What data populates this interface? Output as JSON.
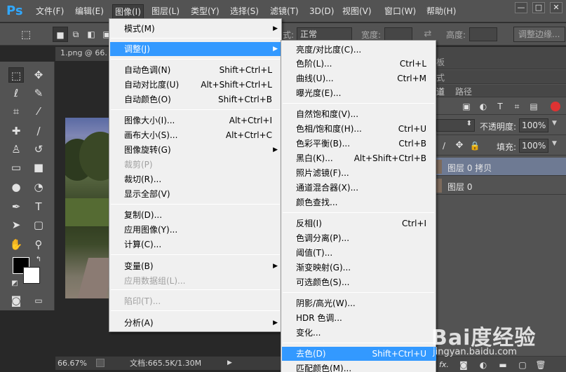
{
  "app": {
    "logo": "Ps"
  },
  "menubar": [
    {
      "label": "文件(F)"
    },
    {
      "label": "编辑(E)"
    },
    {
      "label": "图像(I)"
    },
    {
      "label": "图层(L)"
    },
    {
      "label": "类型(Y)"
    },
    {
      "label": "选择(S)"
    },
    {
      "label": "滤镜(T)"
    },
    {
      "label": "3D(D)"
    },
    {
      "label": "视图(V)"
    },
    {
      "label": "窗口(W)"
    },
    {
      "label": "帮助(H)"
    }
  ],
  "window_controls": {
    "minimize": "—",
    "restore": "□",
    "close": "✕"
  },
  "options": {
    "style_label": "式:",
    "style_value": "正常",
    "width_label": "宽度:",
    "height_label": "高度:",
    "refine_edge": "调整边缘..."
  },
  "document": {
    "tab": "1.png @ 66.",
    "zoom": "66.67%",
    "doc_info": "文档:665.5K/1.30M"
  },
  "panel": {
    "tab_fragment_1": "板",
    "tab_fragment_2": "式",
    "tab_channels": "道",
    "tab_paths": "路径",
    "opacity_label": "不透明度:",
    "opacity_value": "100%",
    "fill_label": "填充:",
    "fill_value": "100%",
    "layers": [
      {
        "name": "图层 0 拷贝",
        "selected": true
      },
      {
        "name": "图层 0",
        "selected": false
      }
    ]
  },
  "image_menu": [
    {
      "label": "模式(M)",
      "shortcut": "",
      "submenu": true
    },
    {
      "label": "调整(J)",
      "shortcut": "",
      "submenu": true,
      "highlight": true
    },
    {
      "label": "自动色调(N)",
      "shortcut": "Shift+Ctrl+L"
    },
    {
      "label": "自动对比度(U)",
      "shortcut": "Alt+Shift+Ctrl+L"
    },
    {
      "label": "自动颜色(O)",
      "shortcut": "Shift+Ctrl+B"
    },
    {
      "label": "图像大小(I)...",
      "shortcut": "Alt+Ctrl+I"
    },
    {
      "label": "画布大小(S)...",
      "shortcut": "Alt+Ctrl+C"
    },
    {
      "label": "图像旋转(G)",
      "shortcut": "",
      "submenu": true
    },
    {
      "label": "裁剪(P)",
      "shortcut": "",
      "disabled": true
    },
    {
      "label": "裁切(R)...",
      "shortcut": ""
    },
    {
      "label": "显示全部(V)",
      "shortcut": ""
    },
    {
      "label": "复制(D)...",
      "shortcut": ""
    },
    {
      "label": "应用图像(Y)...",
      "shortcut": ""
    },
    {
      "label": "计算(C)...",
      "shortcut": ""
    },
    {
      "label": "变量(B)",
      "shortcut": "",
      "submenu": true
    },
    {
      "label": "应用数据组(L)...",
      "shortcut": "",
      "disabled": true
    },
    {
      "label": "陷印(T)...",
      "shortcut": "",
      "disabled": true
    },
    {
      "label": "分析(A)",
      "shortcut": "",
      "submenu": true
    }
  ],
  "adjust_menu": [
    {
      "label": "亮度/对比度(C)...",
      "shortcut": ""
    },
    {
      "label": "色阶(L)...",
      "shortcut": "Ctrl+L"
    },
    {
      "label": "曲线(U)...",
      "shortcut": "Ctrl+M"
    },
    {
      "label": "曝光度(E)...",
      "shortcut": ""
    },
    {
      "label": "自然饱和度(V)...",
      "shortcut": ""
    },
    {
      "label": "色相/饱和度(H)...",
      "shortcut": "Ctrl+U"
    },
    {
      "label": "色彩平衡(B)...",
      "shortcut": "Ctrl+B"
    },
    {
      "label": "黑白(K)...",
      "shortcut": "Alt+Shift+Ctrl+B"
    },
    {
      "label": "照片滤镜(F)...",
      "shortcut": ""
    },
    {
      "label": "通道混合器(X)...",
      "shortcut": ""
    },
    {
      "label": "颜色查找...",
      "shortcut": ""
    },
    {
      "label": "反相(I)",
      "shortcut": "Ctrl+I"
    },
    {
      "label": "色调分离(P)...",
      "shortcut": ""
    },
    {
      "label": "阈值(T)...",
      "shortcut": ""
    },
    {
      "label": "渐变映射(G)...",
      "shortcut": ""
    },
    {
      "label": "可选颜色(S)...",
      "shortcut": ""
    },
    {
      "label": "阴影/高光(W)...",
      "shortcut": ""
    },
    {
      "label": "HDR 色调...",
      "shortcut": ""
    },
    {
      "label": "变化...",
      "shortcut": ""
    },
    {
      "label": "去色(D)",
      "shortcut": "Shift+Ctrl+U",
      "highlight": true
    },
    {
      "label": "匹配颜色(M)...",
      "shortcut": ""
    }
  ],
  "watermark": {
    "brand": "Bai度经验",
    "url": "jingyan.baidu.com"
  },
  "colors": {
    "menu_highlight": "#3399ff",
    "ui_bg": "#535353",
    "canvas_bg": "#282828"
  }
}
